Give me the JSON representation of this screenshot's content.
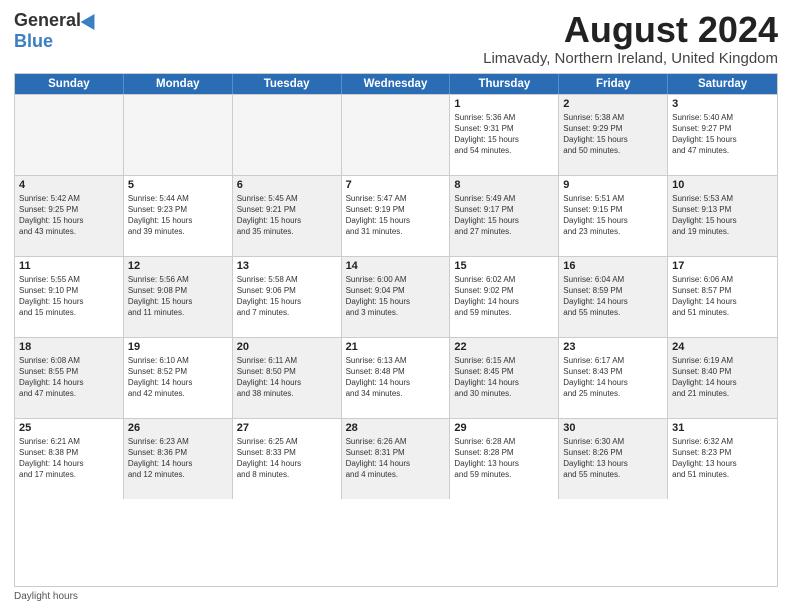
{
  "logo": {
    "general": "General",
    "blue": "Blue"
  },
  "title": {
    "month_year": "August 2024",
    "location": "Limavady, Northern Ireland, United Kingdom"
  },
  "header_days": [
    "Sunday",
    "Monday",
    "Tuesday",
    "Wednesday",
    "Thursday",
    "Friday",
    "Saturday"
  ],
  "weeks": [
    [
      {
        "day": "",
        "info": "",
        "shaded": true,
        "empty": true
      },
      {
        "day": "",
        "info": "",
        "shaded": true,
        "empty": true
      },
      {
        "day": "",
        "info": "",
        "shaded": true,
        "empty": true
      },
      {
        "day": "",
        "info": "",
        "shaded": true,
        "empty": true
      },
      {
        "day": "1",
        "info": "Sunrise: 5:36 AM\nSunset: 9:31 PM\nDaylight: 15 hours\nand 54 minutes."
      },
      {
        "day": "2",
        "info": "Sunrise: 5:38 AM\nSunset: 9:29 PM\nDaylight: 15 hours\nand 50 minutes.",
        "shaded": true
      },
      {
        "day": "3",
        "info": "Sunrise: 5:40 AM\nSunset: 9:27 PM\nDaylight: 15 hours\nand 47 minutes."
      }
    ],
    [
      {
        "day": "4",
        "info": "Sunrise: 5:42 AM\nSunset: 9:25 PM\nDaylight: 15 hours\nand 43 minutes.",
        "shaded": true
      },
      {
        "day": "5",
        "info": "Sunrise: 5:44 AM\nSunset: 9:23 PM\nDaylight: 15 hours\nand 39 minutes."
      },
      {
        "day": "6",
        "info": "Sunrise: 5:45 AM\nSunset: 9:21 PM\nDaylight: 15 hours\nand 35 minutes.",
        "shaded": true
      },
      {
        "day": "7",
        "info": "Sunrise: 5:47 AM\nSunset: 9:19 PM\nDaylight: 15 hours\nand 31 minutes."
      },
      {
        "day": "8",
        "info": "Sunrise: 5:49 AM\nSunset: 9:17 PM\nDaylight: 15 hours\nand 27 minutes.",
        "shaded": true
      },
      {
        "day": "9",
        "info": "Sunrise: 5:51 AM\nSunset: 9:15 PM\nDaylight: 15 hours\nand 23 minutes."
      },
      {
        "day": "10",
        "info": "Sunrise: 5:53 AM\nSunset: 9:13 PM\nDaylight: 15 hours\nand 19 minutes.",
        "shaded": true
      }
    ],
    [
      {
        "day": "11",
        "info": "Sunrise: 5:55 AM\nSunset: 9:10 PM\nDaylight: 15 hours\nand 15 minutes."
      },
      {
        "day": "12",
        "info": "Sunrise: 5:56 AM\nSunset: 9:08 PM\nDaylight: 15 hours\nand 11 minutes.",
        "shaded": true
      },
      {
        "day": "13",
        "info": "Sunrise: 5:58 AM\nSunset: 9:06 PM\nDaylight: 15 hours\nand 7 minutes."
      },
      {
        "day": "14",
        "info": "Sunrise: 6:00 AM\nSunset: 9:04 PM\nDaylight: 15 hours\nand 3 minutes.",
        "shaded": true
      },
      {
        "day": "15",
        "info": "Sunrise: 6:02 AM\nSunset: 9:02 PM\nDaylight: 14 hours\nand 59 minutes."
      },
      {
        "day": "16",
        "info": "Sunrise: 6:04 AM\nSunset: 8:59 PM\nDaylight: 14 hours\nand 55 minutes.",
        "shaded": true
      },
      {
        "day": "17",
        "info": "Sunrise: 6:06 AM\nSunset: 8:57 PM\nDaylight: 14 hours\nand 51 minutes."
      }
    ],
    [
      {
        "day": "18",
        "info": "Sunrise: 6:08 AM\nSunset: 8:55 PM\nDaylight: 14 hours\nand 47 minutes.",
        "shaded": true
      },
      {
        "day": "19",
        "info": "Sunrise: 6:10 AM\nSunset: 8:52 PM\nDaylight: 14 hours\nand 42 minutes."
      },
      {
        "day": "20",
        "info": "Sunrise: 6:11 AM\nSunset: 8:50 PM\nDaylight: 14 hours\nand 38 minutes.",
        "shaded": true
      },
      {
        "day": "21",
        "info": "Sunrise: 6:13 AM\nSunset: 8:48 PM\nDaylight: 14 hours\nand 34 minutes."
      },
      {
        "day": "22",
        "info": "Sunrise: 6:15 AM\nSunset: 8:45 PM\nDaylight: 14 hours\nand 30 minutes.",
        "shaded": true
      },
      {
        "day": "23",
        "info": "Sunrise: 6:17 AM\nSunset: 8:43 PM\nDaylight: 14 hours\nand 25 minutes."
      },
      {
        "day": "24",
        "info": "Sunrise: 6:19 AM\nSunset: 8:40 PM\nDaylight: 14 hours\nand 21 minutes.",
        "shaded": true
      }
    ],
    [
      {
        "day": "25",
        "info": "Sunrise: 6:21 AM\nSunset: 8:38 PM\nDaylight: 14 hours\nand 17 minutes."
      },
      {
        "day": "26",
        "info": "Sunrise: 6:23 AM\nSunset: 8:36 PM\nDaylight: 14 hours\nand 12 minutes.",
        "shaded": true
      },
      {
        "day": "27",
        "info": "Sunrise: 6:25 AM\nSunset: 8:33 PM\nDaylight: 14 hours\nand 8 minutes."
      },
      {
        "day": "28",
        "info": "Sunrise: 6:26 AM\nSunset: 8:31 PM\nDaylight: 14 hours\nand 4 minutes.",
        "shaded": true
      },
      {
        "day": "29",
        "info": "Sunrise: 6:28 AM\nSunset: 8:28 PM\nDaylight: 13 hours\nand 59 minutes."
      },
      {
        "day": "30",
        "info": "Sunrise: 6:30 AM\nSunset: 8:26 PM\nDaylight: 13 hours\nand 55 minutes.",
        "shaded": true
      },
      {
        "day": "31",
        "info": "Sunrise: 6:32 AM\nSunset: 8:23 PM\nDaylight: 13 hours\nand 51 minutes."
      }
    ]
  ],
  "footer": {
    "daylight_label": "Daylight hours"
  }
}
